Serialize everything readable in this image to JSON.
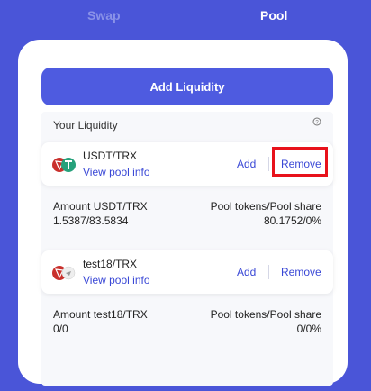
{
  "tabs": {
    "swap": "Swap",
    "pool": "Pool"
  },
  "add_liquidity_label": "Add Liquidity",
  "your_liquidity_label": "Your Liquidity",
  "help_icon": "?",
  "pools": [
    {
      "pair": "USDT/TRX",
      "view_info": "View pool info",
      "add_label": "Add",
      "remove_label": "Remove",
      "amount_label": "Amount  USDT/TRX",
      "amount_value": "1.5387/83.5834",
      "share_label": "Pool tokens/Pool share",
      "share_value": "80.1752/0%"
    },
    {
      "pair": "test18/TRX",
      "view_info": "View pool info",
      "add_label": "Add",
      "remove_label": "Remove",
      "amount_label": "Amount  test18/TRX",
      "amount_value": "0/0",
      "share_label": "Pool tokens/Pool share",
      "share_value": "0/0%"
    }
  ],
  "colors": {
    "background": "#4a55d8",
    "accent": "#4e5be0",
    "link": "#3a48d6",
    "highlight": "#e8121b"
  }
}
